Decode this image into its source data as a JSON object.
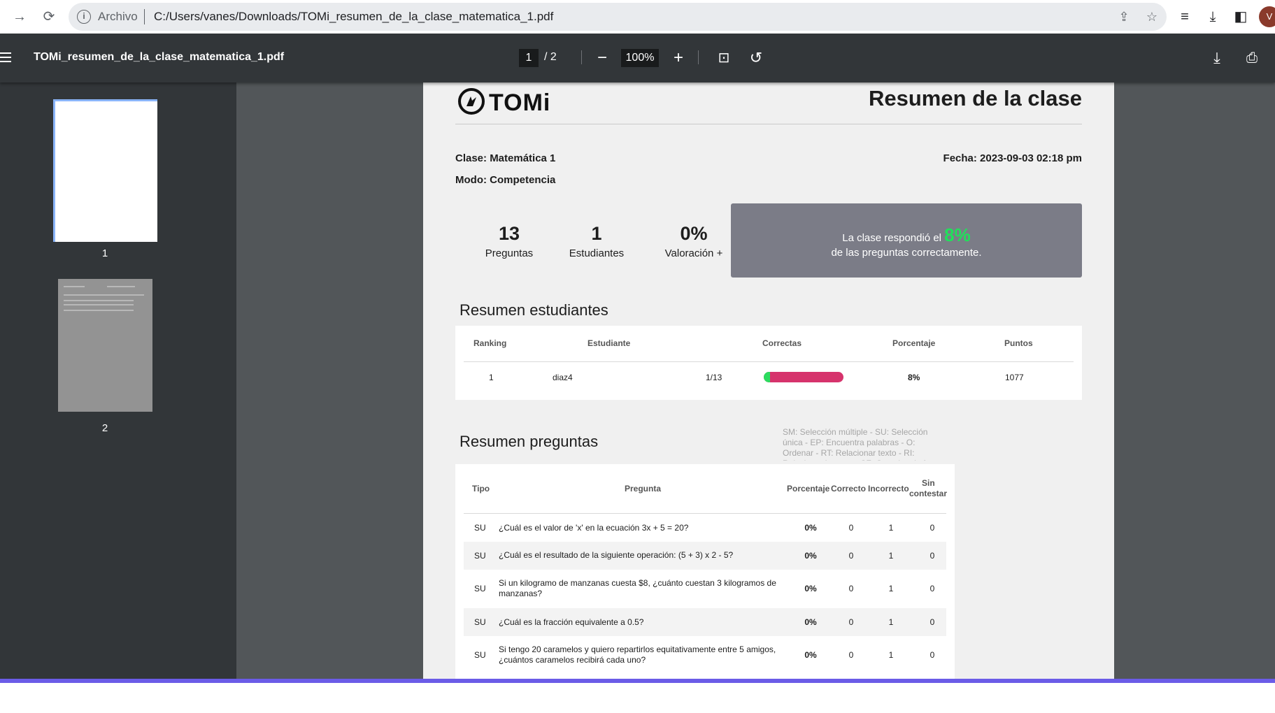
{
  "browser": {
    "url_scheme": "Archivo",
    "url": "C:/Users/vanes/Downloads/TOMi_resumen_de_la_clase_matematica_1.pdf",
    "avatar_initial": "V"
  },
  "pdf_toolbar": {
    "title": "TOMi_resumen_de_la_clase_matematica_1.pdf",
    "current_page": "1",
    "total_pages": "/ 2",
    "zoom": "100%"
  },
  "sidebar": {
    "thumbnails": [
      {
        "label": "1",
        "selected": true
      },
      {
        "label": "2",
        "selected": false
      }
    ]
  },
  "document": {
    "logo_text": "TOMi",
    "title": "Resumen de la clase",
    "clase": "Clase: Matemática 1",
    "modo": "Modo: Competencia",
    "fecha": "Fecha: 2023-09-03 02:18 pm",
    "stats": [
      {
        "value": "13",
        "label": "Preguntas"
      },
      {
        "value": "1",
        "label": "Estudiantes"
      },
      {
        "value": "0%",
        "label": "Valoración +"
      }
    ],
    "answer_box": {
      "prefix": "La clase respondió el",
      "percent": "8%",
      "suffix": "de las preguntas correctamente.",
      "percent_color": "#21e05a",
      "box_color": "#7b7c87"
    },
    "students_section": {
      "title": "Resumen estudiantes",
      "headers": [
        "Ranking",
        "Estudiante",
        "Correctas",
        "Porcentaje",
        "Puntos"
      ],
      "rows": [
        {
          "ranking": "1",
          "student": "diaz4",
          "correct": "1/13",
          "correct_fraction": 0.077,
          "percentage": "8%",
          "points": "1077"
        }
      ],
      "bar_colors": {
        "correct": "#2bdc5f",
        "incorrect": "#d6336c"
      }
    },
    "questions_section": {
      "title": "Resumen preguntas",
      "legend": "SM: Selección múltiple - SU: Selección única - EP: Encuentra palabras - O: Ordenar - RT: Relacionar texto - RI: Relacionar imagen - CF: Completa la frase",
      "headers": {
        "tipo": "Tipo",
        "pregunta": "Pregunta",
        "porcentaje": "Porcentaje",
        "correcto": "Correcto",
        "incorrecto": "Incorrecto",
        "sin_contestar_1": "Sin",
        "sin_contestar_2": "contestar"
      },
      "rows": [
        {
          "type": "SU",
          "question": "¿Cuál es el valor de 'x' en la ecuación 3x + 5 = 20?",
          "percentage": "0%",
          "correct": "0",
          "incorrect": "1",
          "unanswered": "0"
        },
        {
          "type": "SU",
          "question": "¿Cuál es el resultado de la siguiente operación: (5 + 3) x 2 - 5?",
          "percentage": "0%",
          "correct": "0",
          "incorrect": "1",
          "unanswered": "0"
        },
        {
          "type": "SU",
          "question": "Si un kilogramo de manzanas cuesta $8, ¿cuánto cuestan 3 kilogramos de manzanas?",
          "percentage": "0%",
          "correct": "0",
          "incorrect": "1",
          "unanswered": "0"
        },
        {
          "type": "SU",
          "question": "¿Cuál es la fracción equivalente a 0.5?",
          "percentage": "0%",
          "correct": "0",
          "incorrect": "1",
          "unanswered": "0"
        },
        {
          "type": "SU",
          "question": "Si tengo 20 caramelos y quiero repartirlos equitativamente entre 5 amigos, ¿cuántos caramelos recibirá cada uno?",
          "percentage": "0%",
          "correct": "0",
          "incorrect": "1",
          "unanswered": "0"
        }
      ]
    }
  },
  "colors": {
    "toolbar_bg": "#323639",
    "viewer_bg": "#525659",
    "accent_bar": "#6b5ce7"
  }
}
